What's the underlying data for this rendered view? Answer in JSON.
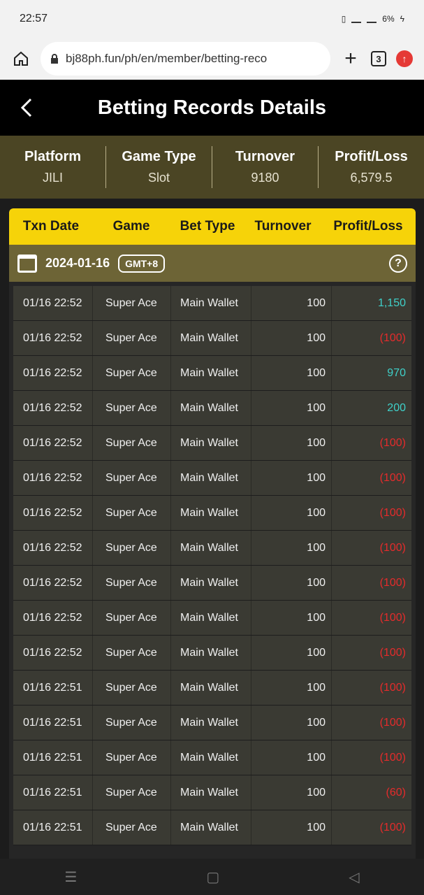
{
  "status": {
    "time": "22:57",
    "battery": "6%"
  },
  "browser": {
    "url": "bj88ph.fun/ph/en/member/betting-reco",
    "tab_count": "3",
    "plus": "+"
  },
  "header": {
    "title": "Betting Records Details",
    "back": "<"
  },
  "summary": [
    {
      "label": "Platform",
      "value": "JILI"
    },
    {
      "label": "Game Type",
      "value": "Slot"
    },
    {
      "label": "Turnover",
      "value": "9180"
    },
    {
      "label": "Profit/Loss",
      "value": "6,579.5"
    }
  ],
  "table": {
    "headers": [
      "Txn Date",
      "Game",
      "Bet Type",
      "Turnover",
      "Profit/Loss"
    ],
    "date": "2024-01-16",
    "timezone": "GMT+8",
    "help": "?",
    "rows": [
      {
        "date": "01/16 22:52",
        "game": "Super Ace",
        "bet_type": "Main Wallet",
        "turnover": "100",
        "pl": "1,150",
        "sign": "pos"
      },
      {
        "date": "01/16 22:52",
        "game": "Super Ace",
        "bet_type": "Main Wallet",
        "turnover": "100",
        "pl": "(100)",
        "sign": "neg"
      },
      {
        "date": "01/16 22:52",
        "game": "Super Ace",
        "bet_type": "Main Wallet",
        "turnover": "100",
        "pl": "970",
        "sign": "pos"
      },
      {
        "date": "01/16 22:52",
        "game": "Super Ace",
        "bet_type": "Main Wallet",
        "turnover": "100",
        "pl": "200",
        "sign": "pos"
      },
      {
        "date": "01/16 22:52",
        "game": "Super Ace",
        "bet_type": "Main Wallet",
        "turnover": "100",
        "pl": "(100)",
        "sign": "neg"
      },
      {
        "date": "01/16 22:52",
        "game": "Super Ace",
        "bet_type": "Main Wallet",
        "turnover": "100",
        "pl": "(100)",
        "sign": "neg"
      },
      {
        "date": "01/16 22:52",
        "game": "Super Ace",
        "bet_type": "Main Wallet",
        "turnover": "100",
        "pl": "(100)",
        "sign": "neg"
      },
      {
        "date": "01/16 22:52",
        "game": "Super Ace",
        "bet_type": "Main Wallet",
        "turnover": "100",
        "pl": "(100)",
        "sign": "neg"
      },
      {
        "date": "01/16 22:52",
        "game": "Super Ace",
        "bet_type": "Main Wallet",
        "turnover": "100",
        "pl": "(100)",
        "sign": "neg"
      },
      {
        "date": "01/16 22:52",
        "game": "Super Ace",
        "bet_type": "Main Wallet",
        "turnover": "100",
        "pl": "(100)",
        "sign": "neg"
      },
      {
        "date": "01/16 22:52",
        "game": "Super Ace",
        "bet_type": "Main Wallet",
        "turnover": "100",
        "pl": "(100)",
        "sign": "neg"
      },
      {
        "date": "01/16 22:51",
        "game": "Super Ace",
        "bet_type": "Main Wallet",
        "turnover": "100",
        "pl": "(100)",
        "sign": "neg"
      },
      {
        "date": "01/16 22:51",
        "game": "Super Ace",
        "bet_type": "Main Wallet",
        "turnover": "100",
        "pl": "(100)",
        "sign": "neg"
      },
      {
        "date": "01/16 22:51",
        "game": "Super Ace",
        "bet_type": "Main Wallet",
        "turnover": "100",
        "pl": "(100)",
        "sign": "neg"
      },
      {
        "date": "01/16 22:51",
        "game": "Super Ace",
        "bet_type": "Main Wallet",
        "turnover": "100",
        "pl": "(60)",
        "sign": "neg"
      },
      {
        "date": "01/16 22:51",
        "game": "Super Ace",
        "bet_type": "Main Wallet",
        "turnover": "100",
        "pl": "(100)",
        "sign": "neg"
      }
    ]
  },
  "nav": {
    "menu": "☰",
    "home": "▢",
    "back": "◁"
  }
}
